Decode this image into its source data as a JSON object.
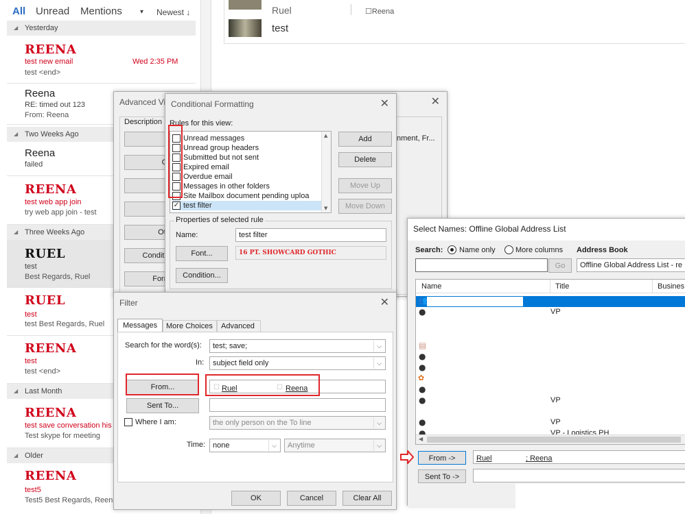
{
  "filters": {
    "all": "All",
    "unread": "Unread",
    "mentions": "Mentions",
    "sort": "Newest",
    "sort_arrow": "↓"
  },
  "groups": {
    "yesterday": "Yesterday",
    "two_weeks": "Two Weeks Ago",
    "three_weeks": "Three Weeks Ago",
    "last_month": "Last Month",
    "older": "Older"
  },
  "messages": [
    {
      "sender": "REENA",
      "subject": "test new email",
      "time": "Wed 2:35 PM",
      "preview": "test <end>"
    },
    {
      "sender": "Reena",
      "subject": "RE: timed out 123",
      "preview": "From: Reena"
    },
    {
      "sender": "Reena",
      "subject": "failed"
    },
    {
      "sender": "REENA",
      "subject": "test web app join",
      "preview": "try web app join - test"
    },
    {
      "sender": "RUEL",
      "subject": "test",
      "preview": "Best Regards,  Ruel"
    },
    {
      "sender": "RUEL",
      "subject": "test",
      "preview": "test  Best Regards,  Ruel"
    },
    {
      "sender": "REENA",
      "subject": "test",
      "preview": "test <end>"
    },
    {
      "sender": "REENA",
      "subject": "test save conversation his",
      "preview": "Test skype for meeting"
    },
    {
      "sender": "REENA",
      "subject": "test5",
      "preview": "Test5  Best Regards,  Reen"
    }
  ],
  "reading": {
    "sender": "Ruel",
    "recipient": "Reena",
    "subject": "test"
  },
  "adv": {
    "title": "Advanced Vi",
    "desc": "Description",
    "b1": "Co",
    "b2": "Gro",
    "b3": "",
    "b4": "F",
    "b5": "Othe",
    "b6": "Condition",
    "b7": "Forma",
    "side_text": "nment, Fr..."
  },
  "cf": {
    "title": "Conditional Formatting",
    "rules_label": "Rules for this view:",
    "rules": [
      {
        "label": "Unread messages",
        "checked": false
      },
      {
        "label": "Unread group headers",
        "checked": false
      },
      {
        "label": "Submitted but not sent",
        "checked": false
      },
      {
        "label": "Expired email",
        "checked": false
      },
      {
        "label": "Overdue email",
        "checked": false
      },
      {
        "label": "Messages in other folders",
        "checked": false
      },
      {
        "label": "Site Mailbox document pending uploa",
        "checked": false
      },
      {
        "label": "test filter",
        "checked": true
      }
    ],
    "add": "Add",
    "delete": "Delete",
    "move_up": "Move Up",
    "move_down": "Move Down",
    "props_label": "Properties of selected rule",
    "name_label": "Name:",
    "name_value": "test filter",
    "font_btn": "Font...",
    "font_sample": "16 PT. SHOWCARD GOTHIC",
    "condition_btn": "Condition..."
  },
  "filter": {
    "title": "Filter",
    "tabs": [
      "Messages",
      "More Choices",
      "Advanced"
    ],
    "search_label": "Search for the word(s):",
    "search_value": "test; save;",
    "in_label": "In:",
    "in_value": "subject field only",
    "from_btn": "From...",
    "from_names": [
      "Ruel",
      "Reena"
    ],
    "sentto_btn": "Sent To...",
    "where_label": "Where I am:",
    "where_value": "the only person on the To line",
    "time_label": "Time:",
    "time_value": "none",
    "time_range": "Anytime",
    "ok": "OK",
    "cancel": "Cancel",
    "clear": "Clear All"
  },
  "sn": {
    "title": "Select Names: Offline Global Address List",
    "search_label": "Search:",
    "name_only": "Name only",
    "more_columns": "More columns",
    "ab_label": "Address Book",
    "go": "Go",
    "ab_value": "Offline Global Address List - re",
    "cols": [
      "Name",
      "Title",
      "Busines"
    ],
    "titles": [
      "VP",
      "VP",
      "VP",
      "VP - Logistics PH"
    ],
    "from_btn": "From ->",
    "from_value": "Ruel",
    "from_value2": "; Reena",
    "sentto_btn": "Sent To ->"
  }
}
